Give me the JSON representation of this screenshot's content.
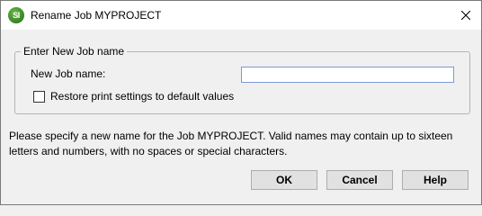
{
  "window": {
    "title": "Rename Job MYPROJECT",
    "app_icon_text": "SI"
  },
  "group": {
    "legend": "Enter New Job name",
    "field_label": "New Job name:",
    "field_value": "",
    "checkbox_label": "Restore print settings to default values",
    "checkbox_checked": false
  },
  "message": {
    "line1": "Please specify a new name for the Job MYPROJECT.  Valid names may contain up to sixteen",
    "line2": "letters and numbers, with no spaces or special characters."
  },
  "buttons": {
    "ok": "OK",
    "cancel": "Cancel",
    "help": "Help"
  },
  "colors": {
    "dialog_bg": "#f0f0f0",
    "titlebar_bg": "#ffffff",
    "input_border": "#7a9cd3",
    "app_icon": "#3d8a2a"
  },
  "icons": {
    "app": "si-app-icon",
    "close": "close-icon"
  }
}
